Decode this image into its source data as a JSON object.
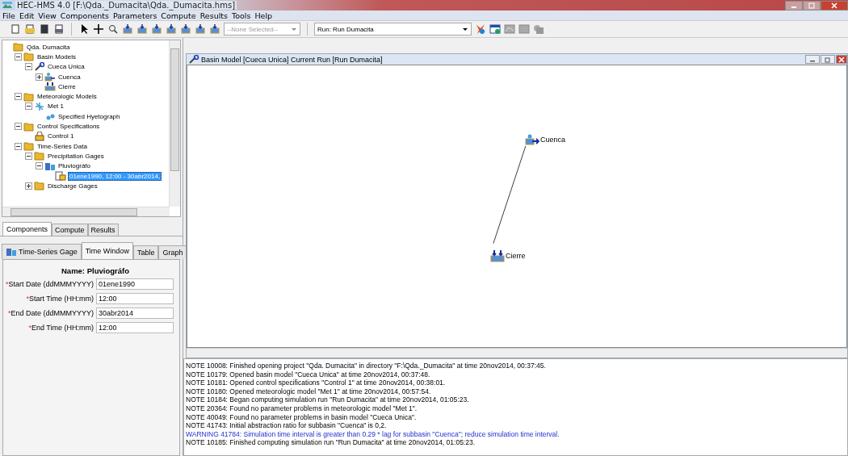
{
  "window": {
    "title": "HEC-HMS 4.0 [F:\\Qda._Dumacita\\Qda._Dumacita.hms]"
  },
  "menu": [
    "File",
    "Edit",
    "View",
    "Components",
    "Parameters",
    "Compute",
    "Results",
    "Tools",
    "Help"
  ],
  "toolbar": {
    "element_selector": "--None Selected--",
    "run_selector": "Run: Run Dumacita"
  },
  "tree": [
    {
      "label": "Qda. Dumacita",
      "kind": "folder",
      "children": [
        {
          "label": "Basin Models",
          "kind": "folder",
          "expanded": true,
          "children": [
            {
              "label": "Cueca Unica",
              "kind": "basin",
              "expanded": true,
              "children": [
                {
                  "label": "Cuenca",
                  "kind": "subbasin",
                  "expanded": false
                },
                {
                  "label": "Cierre",
                  "kind": "sink"
                }
              ]
            }
          ]
        },
        {
          "label": "Meteorologic Models",
          "kind": "folder",
          "expanded": true,
          "children": [
            {
              "label": "Met 1",
              "kind": "met",
              "expanded": true,
              "children": [
                {
                  "label": "Specified Hyetograph",
                  "kind": "hyeto"
                }
              ]
            }
          ]
        },
        {
          "label": "Control Specifications",
          "kind": "folder",
          "expanded": true,
          "children": [
            {
              "label": "Control 1",
              "kind": "control"
            }
          ]
        },
        {
          "label": "Time-Series Data",
          "kind": "folder",
          "expanded": true,
          "children": [
            {
              "label": "Precipitation Gages",
              "kind": "folder",
              "expanded": true,
              "children": [
                {
                  "label": "Pluviográfo",
                  "kind": "gage",
                  "expanded": true,
                  "children": [
                    {
                      "label": "01ene1990, 12:00 - 30abr2014,",
                      "kind": "series",
                      "selected": true
                    }
                  ]
                }
              ]
            },
            {
              "label": "Discharge Gages",
              "kind": "folder",
              "expanded": false
            }
          ]
        }
      ]
    }
  ],
  "panel_tabs": [
    {
      "label": "Components",
      "selected": true
    },
    {
      "label": "Compute",
      "selected": false
    },
    {
      "label": "Results",
      "selected": false
    }
  ],
  "editor_tabs": [
    {
      "label": "Time-Series Gage",
      "selected": false,
      "kind": "gage"
    },
    {
      "label": "Time Window",
      "selected": true
    },
    {
      "label": "Table",
      "selected": false
    },
    {
      "label": "Graph",
      "selected": false
    }
  ],
  "form": {
    "name": "Name: Pluviográfo",
    "fields": [
      {
        "mark": "*",
        "label": "Start Date (ddMMMYYYY)",
        "value": "01ene1990"
      },
      {
        "mark": "*",
        "label": "Start Time (HH:mm)",
        "value": "12:00"
      },
      {
        "mark": "*",
        "label": "End Date (ddMMMYYYY)",
        "value": "30abr2014"
      },
      {
        "mark": "*",
        "label": "End Time (HH:mm)",
        "value": "12:00"
      }
    ]
  },
  "basin_window": {
    "title": "Basin Model [Cueca Unica]  Current Run [Run Dumacita]",
    "elements": [
      {
        "label": "Cuenca",
        "kind": "subbasin"
      },
      {
        "label": "Cierre",
        "kind": "sink"
      }
    ]
  },
  "log": [
    {
      "kind": "note",
      "text": "NOTE 10008:  Finished opening project \"Qda. Dumacita\" in directory \"F:\\Qda._Dumacita\" at time 20nov2014, 00:37:45."
    },
    {
      "kind": "note",
      "text": "NOTE 10179:  Opened basin model \"Cueca Unica\" at time 20nov2014, 00:37:48."
    },
    {
      "kind": "note",
      "text": "NOTE 10181:  Opened control specifications \"Control 1\" at time 20nov2014, 00:38:01."
    },
    {
      "kind": "note",
      "text": "NOTE 10180:  Opened meteorologic model \"Met 1\" at time 20nov2014, 00:57:54."
    },
    {
      "kind": "note",
      "text": "NOTE 10184:  Began computing simulation run \"Run Dumacita\" at time 20nov2014, 01:05:23."
    },
    {
      "kind": "note",
      "text": "NOTE 20364:  Found no parameter problems in meteorologic model \"Met 1\"."
    },
    {
      "kind": "note",
      "text": "NOTE 40049:  Found no parameter problems in basin model \"Cueca Unica\"."
    },
    {
      "kind": "note",
      "text": "NOTE 41743:  Initial abstraction ratio for subbasin \"Cuenca\" is 0,2."
    },
    {
      "kind": "warning",
      "text": "WARNING 41784:  Simulation time interval is greater than 0.29 * lag for subbasin \"Cuenca\"; reduce simulation time interval."
    },
    {
      "kind": "note",
      "text": "NOTE 10185:  Finished computing simulation run \"Run Dumacita\" at time 20nov2014, 01:05:23."
    }
  ]
}
